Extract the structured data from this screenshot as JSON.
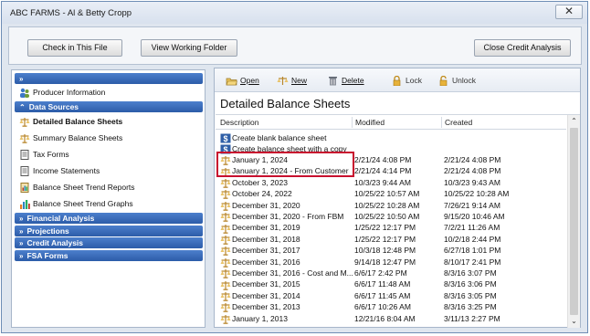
{
  "window": {
    "title": "ABC FARMS - Al & Betty Cropp",
    "close_label": "✕"
  },
  "topbar": {
    "check_in_label": "Check in This File",
    "view_folder_label": "View Working Folder",
    "close_analysis_label": "Close Credit Analysis"
  },
  "sidebar": {
    "top_chevron": "»",
    "producer_info": "Producer Information",
    "data_sources": {
      "label": "Data Sources",
      "items": [
        "Detailed Balance Sheets",
        "Summary Balance Sheets",
        "Tax Forms",
        "Income Statements",
        "Balance Sheet Trend Reports",
        "Balance Sheet Trend Graphs"
      ]
    },
    "sections": [
      "Financial Analysis",
      "Projections",
      "Credit Analysis",
      "FSA Forms"
    ]
  },
  "toolbar": {
    "open": "Open",
    "new": "New",
    "delete": "Delete",
    "lock": "Lock",
    "unlock": "Unlock"
  },
  "pane": {
    "title": "Detailed Balance Sheets",
    "columns": [
      "Description",
      "Modified",
      "Created"
    ],
    "actions": [
      "Create blank balance sheet",
      "Create balance sheet with a copy"
    ],
    "rows": [
      [
        "January 1, 2024",
        "2/21/24 4:08 PM",
        "2/21/24 4:08 PM"
      ],
      [
        "January 1, 2024 - From Customer",
        "2/21/24 4:14 PM",
        "2/21/24 4:08 PM"
      ],
      [
        "October 3, 2023",
        "10/3/23 9:44 AM",
        "10/3/23 9:43 AM"
      ],
      [
        "October 24, 2022",
        "10/25/22 10:57 AM",
        "10/25/22 10:28 AM"
      ],
      [
        "December 31, 2020",
        "10/25/22 10:28 AM",
        "7/26/21 9:14 AM"
      ],
      [
        "December 31, 2020 - From FBM",
        "10/25/22 10:50 AM",
        "9/15/20 10:46 AM"
      ],
      [
        "December 31, 2019",
        "1/25/22 12:17 PM",
        "7/2/21 11:26 AM"
      ],
      [
        "December 31, 2018",
        "1/25/22 12:17 PM",
        "10/2/18 2:44 PM"
      ],
      [
        "December 31, 2017",
        "10/3/18 12:48 PM",
        "6/27/18 1:01 PM"
      ],
      [
        "December 31, 2016",
        "9/14/18 12:47 PM",
        "8/10/17 2:41 PM"
      ],
      [
        "December 31, 2016 - Cost and M...",
        "6/6/17 2:42 PM",
        "8/3/16 3:07 PM"
      ],
      [
        "December 31, 2015",
        "6/6/17 11:48 AM",
        "8/3/16 3:06 PM"
      ],
      [
        "December 31, 2014",
        "6/6/17 11:45 AM",
        "8/3/16 3:05 PM"
      ],
      [
        "December 31, 2013",
        "6/6/17 10:26 AM",
        "8/3/16 3:25 PM"
      ],
      [
        "January 1, 2013",
        "12/21/16 8:04 AM",
        "3/11/13 2:27 PM"
      ]
    ]
  }
}
